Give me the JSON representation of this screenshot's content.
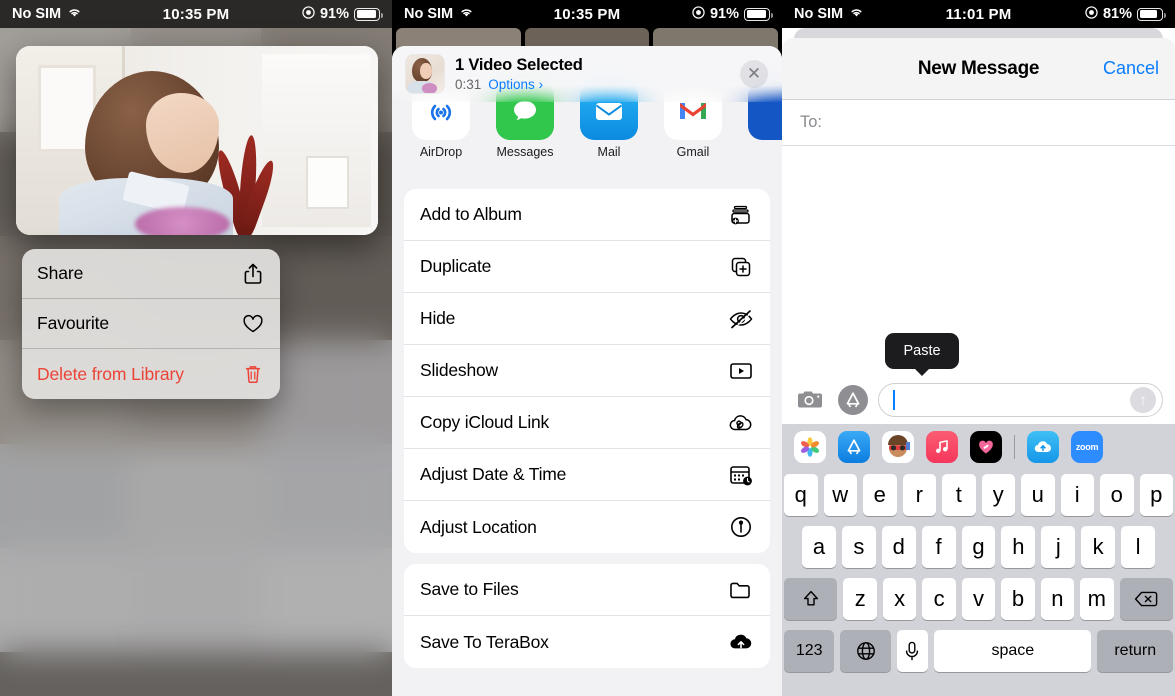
{
  "panel1": {
    "status": {
      "carrier": "No SIM",
      "wifi_icon": "wifi-icon",
      "time": "10:35 PM",
      "battery_pct": "91%",
      "location_icon": "location-icon"
    },
    "context_menu": [
      {
        "label": "Share",
        "icon": "share-icon",
        "destructive": false
      },
      {
        "label": "Favourite",
        "icon": "heart-icon",
        "destructive": false
      },
      {
        "label": "Delete from Library",
        "icon": "trash-icon",
        "destructive": true
      }
    ]
  },
  "panel2": {
    "status": {
      "carrier": "No SIM",
      "wifi_icon": "wifi-icon",
      "time": "10:35 PM",
      "battery_pct": "91%",
      "location_icon": "location-icon"
    },
    "sheet": {
      "title": "1 Video Selected",
      "duration": "0:31",
      "options_label": "Options",
      "options_chevron": "chevron-right-icon",
      "close_icon": "close-icon",
      "thumbnail": "video-thumbnail"
    },
    "apps": [
      {
        "label": "AirDrop",
        "icon": "airdrop-icon",
        "color": "#ffffff"
      },
      {
        "label": "Messages",
        "icon": "messages-icon",
        "color": "#30c74c"
      },
      {
        "label": "Mail",
        "icon": "mail-icon",
        "color": "#1fa8f0"
      },
      {
        "label": "Gmail",
        "icon": "gmail-icon",
        "color": "#ffffff"
      },
      {
        "label": "",
        "icon": "facebook-icon",
        "color": "#1456c4"
      }
    ],
    "groups": [
      [
        {
          "label": "Add to Album",
          "icon": "add-to-album-icon"
        },
        {
          "label": "Duplicate",
          "icon": "duplicate-icon"
        },
        {
          "label": "Hide",
          "icon": "hide-eye-icon"
        },
        {
          "label": "Slideshow",
          "icon": "slideshow-icon"
        },
        {
          "label": "Copy iCloud Link",
          "icon": "icloud-link-icon"
        },
        {
          "label": "Adjust Date & Time",
          "icon": "calendar-clock-icon"
        },
        {
          "label": "Adjust Location",
          "icon": "location-pin-icon"
        }
      ],
      [
        {
          "label": "Save to Files",
          "icon": "folder-icon"
        },
        {
          "label": "Save To TeraBox",
          "icon": "cloud-upload-icon"
        }
      ]
    ]
  },
  "panel3": {
    "status": {
      "carrier": "No SIM",
      "wifi_icon": "wifi-icon",
      "time": "11:01 PM",
      "battery_pct": "81%",
      "location_icon": "location-icon"
    },
    "nav": {
      "title": "New Message",
      "cancel": "Cancel"
    },
    "to_field": {
      "label": "To:",
      "value": ""
    },
    "tooltip": {
      "label": "Paste"
    },
    "input": {
      "value": "",
      "placeholder": "",
      "send_icon": "send-arrow-icon",
      "camera_icon": "camera-icon",
      "appstore_icon": "appstore-icon"
    },
    "app_drawer": [
      {
        "icon": "photos-icon"
      },
      {
        "icon": "appstore-icon"
      },
      {
        "icon": "memoji-icon"
      },
      {
        "icon": "music-icon"
      },
      {
        "icon": "fitness-icon"
      },
      {
        "icon": "onedrive-icon"
      },
      {
        "icon": "zoom-icon",
        "label": "zoom"
      }
    ],
    "keyboard": {
      "row1": [
        "q",
        "w",
        "e",
        "r",
        "t",
        "y",
        "u",
        "i",
        "o",
        "p"
      ],
      "row2": [
        "a",
        "s",
        "d",
        "f",
        "g",
        "h",
        "j",
        "k",
        "l"
      ],
      "row3": [
        "z",
        "x",
        "c",
        "v",
        "b",
        "n",
        "m"
      ],
      "shift_icon": "shift-icon",
      "backspace_icon": "backspace-icon",
      "numbers_key": "123",
      "globe_icon": "globe-icon",
      "mic_icon": "microphone-icon",
      "space_key": "space",
      "return_key": "return"
    }
  },
  "colors": {
    "accent": "#0a7cff",
    "destructive": "#ec4337",
    "sheet_bg": "#f2f2f4"
  }
}
